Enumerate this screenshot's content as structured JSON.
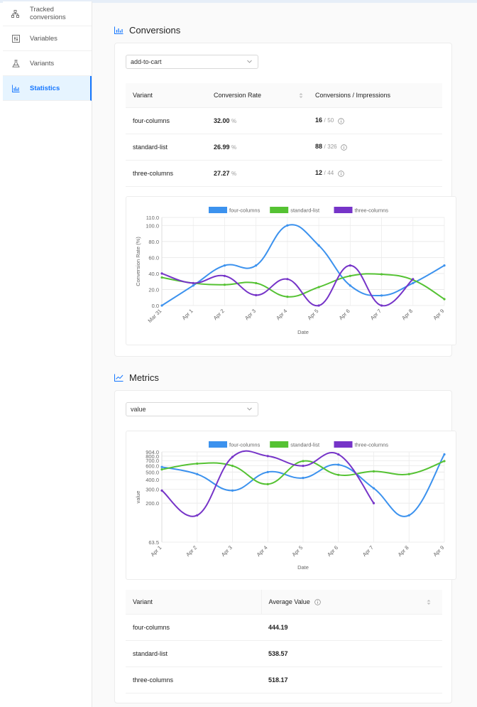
{
  "sidebar": {
    "items": [
      {
        "label": "Tracked conversions",
        "icon": "hierarchy-icon"
      },
      {
        "label": "Variables",
        "icon": "sliders-icon"
      },
      {
        "label": "Variants",
        "icon": "flask-icon"
      },
      {
        "label": "Statistics",
        "icon": "bar-chart-icon",
        "active": true
      }
    ]
  },
  "conversions": {
    "title": "Conversions",
    "selected": "add-to-cart",
    "table": {
      "headers": [
        "Variant",
        "Conversion Rate",
        "Conversions / Impressions"
      ],
      "rows": [
        {
          "variant": "four-columns",
          "rate": "32.00",
          "unit": "%",
          "conversions": "16",
          "impressions": "50"
        },
        {
          "variant": "standard-list",
          "rate": "26.99",
          "unit": "%",
          "conversions": "88",
          "impressions": "326"
        },
        {
          "variant": "three-columns",
          "rate": "27.27",
          "unit": "%",
          "conversions": "12",
          "impressions": "44"
        }
      ]
    }
  },
  "metrics": {
    "title": "Metrics",
    "selected": "value",
    "table": {
      "headers": [
        "Variant",
        "Average Value"
      ],
      "rows": [
        {
          "variant": "four-columns",
          "avg": "444.19"
        },
        {
          "variant": "standard-list",
          "avg": "538.57"
        },
        {
          "variant": "three-columns",
          "avg": "518.17"
        }
      ]
    }
  },
  "colors": {
    "four-columns": "#3c92ee",
    "standard-list": "#55c233",
    "three-columns": "#7634c8",
    "accent": "#1677ff"
  },
  "chart_data": [
    {
      "type": "line",
      "xlabel": "Date",
      "ylabel": "Conversion Rate (%)",
      "categories": [
        "Mar 31",
        "Apr 1",
        "Apr 2",
        "Apr 3",
        "Apr 4",
        "Apr 5",
        "Apr 6",
        "Apr 7",
        "Apr 8",
        "Apr 9"
      ],
      "ylim": [
        0,
        110
      ],
      "yticks": [
        "0.0",
        "20.0",
        "40.0",
        "60.0",
        "80.0",
        "100.0",
        "110.0"
      ],
      "grid": true,
      "legend": "top",
      "series": [
        {
          "name": "four-columns",
          "values": [
            0,
            25,
            50,
            50,
            100,
            75,
            25,
            12.5,
            28,
            50
          ]
        },
        {
          "name": "standard-list",
          "values": [
            35,
            28,
            26,
            28,
            11,
            23,
            37,
            39,
            32,
            8
          ]
        },
        {
          "name": "three-columns",
          "values": [
            40,
            28,
            37,
            13,
            33,
            0,
            50,
            0,
            33,
            null
          ]
        }
      ]
    },
    {
      "type": "line",
      "xlabel": "Date",
      "ylabel": "value",
      "categories": [
        "Apr 1",
        "Apr 2",
        "Apr 3",
        "Apr 4",
        "Apr 5",
        "Apr 6",
        "Apr 7",
        "Apr 8",
        "Apr 9"
      ],
      "ylim": [
        63.5,
        904
      ],
      "yscale": "log",
      "yticks": [
        "63.5",
        "200.0",
        "300.0",
        "400.0",
        "500.0",
        "600.0",
        "700.0",
        "800.0",
        "904.0"
      ],
      "grid": true,
      "legend": "top",
      "series": [
        {
          "name": "four-columns",
          "values": [
            580,
            470,
            290,
            500,
            420,
            620,
            310,
            140,
            840
          ]
        },
        {
          "name": "standard-list",
          "values": [
            540,
            640,
            600,
            350,
            690,
            460,
            510,
            470,
            690
          ]
        },
        {
          "name": "three-columns",
          "values": [
            290,
            140,
            780,
            800,
            600,
            840,
            200,
            null,
            null
          ]
        }
      ]
    }
  ]
}
